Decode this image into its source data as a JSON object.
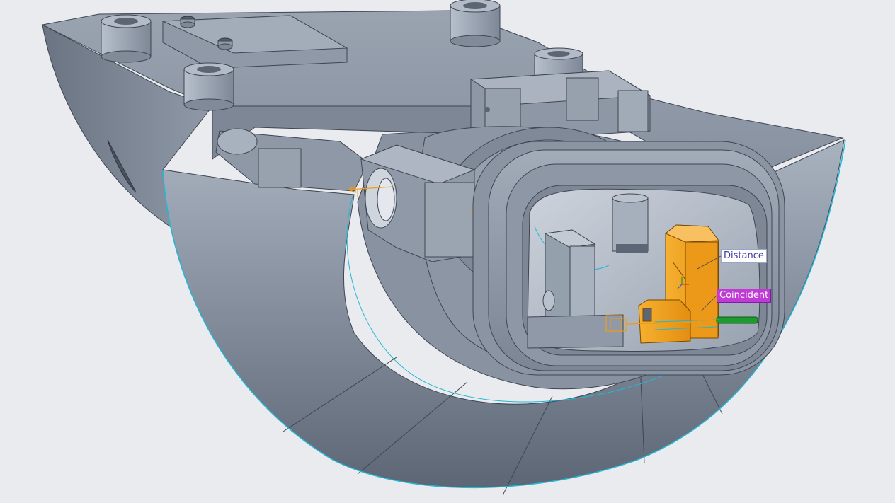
{
  "viewport": {
    "background": "#e9ebef"
  },
  "constraints": {
    "distance": {
      "label": "Distance",
      "color": "#ffffff",
      "text_color": "#3a3aa0"
    },
    "coincident": {
      "label": "Coincident",
      "color": "#c23ad6",
      "text_color": "#ffffff"
    }
  },
  "colors": {
    "model_body": "#8e98a6",
    "model_dark": "#5c6573",
    "model_light": "#b6bfcc",
    "selected_part": "#f0a01e",
    "selection_edge": "#22b8d6",
    "highlight_green": "#1f9a2e",
    "dragger": "#f29a14"
  },
  "icons": {
    "move_dragger": "move-arrow-icon",
    "rotate_dragger": "rotate-arrow-icon",
    "coordinate_triad": "triad-icon"
  }
}
